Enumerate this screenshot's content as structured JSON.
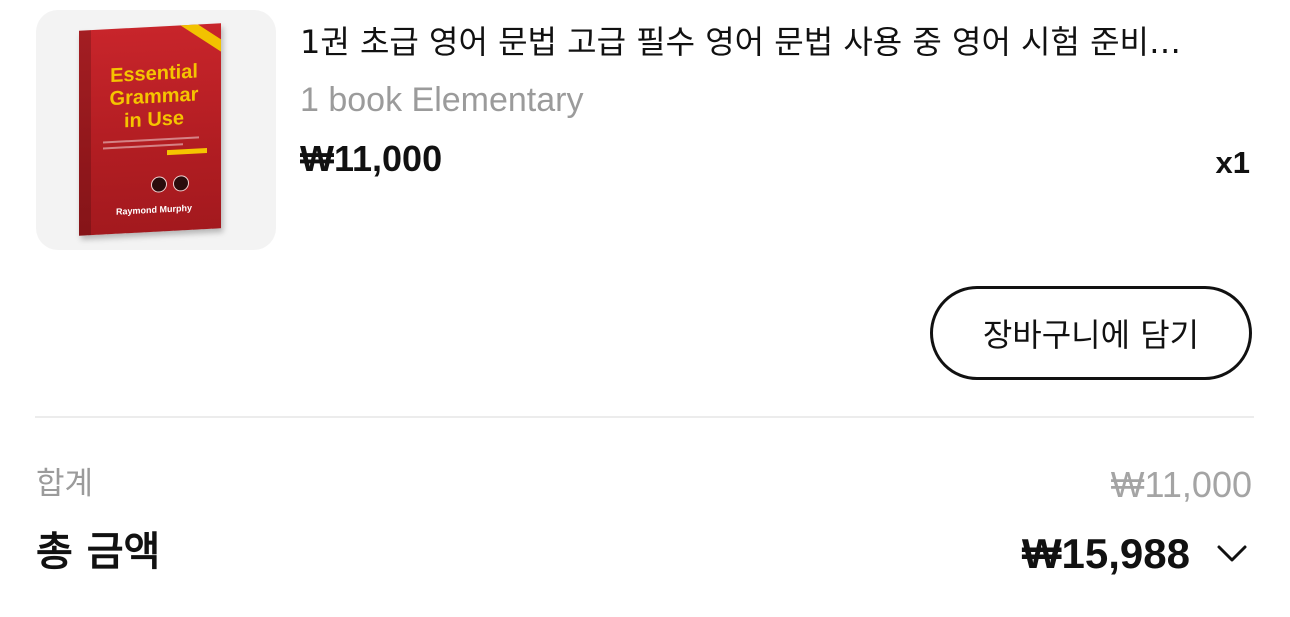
{
  "product": {
    "title": "1권 초급 영어 문법 고급 필수 영어 문법 사용 중 영어 시험 준비…",
    "option": "1 book Elementary",
    "price": "₩11,000",
    "quantity": "x1",
    "image": {
      "cover_title_line1": "Essential",
      "cover_title_line2": "Grammar",
      "cover_title_line3": "in Use",
      "cover_author": "Raymond Murphy",
      "cover_color": "#b11d22",
      "title_color": "#f5c400"
    }
  },
  "actions": {
    "add_to_cart_label": "장바구니에 담기"
  },
  "summary": {
    "subtotal_label": "합계",
    "subtotal_value": "₩11,000",
    "total_label": "총 금액",
    "total_value": "₩15,988",
    "expand_icon": "chevron-down-icon"
  }
}
